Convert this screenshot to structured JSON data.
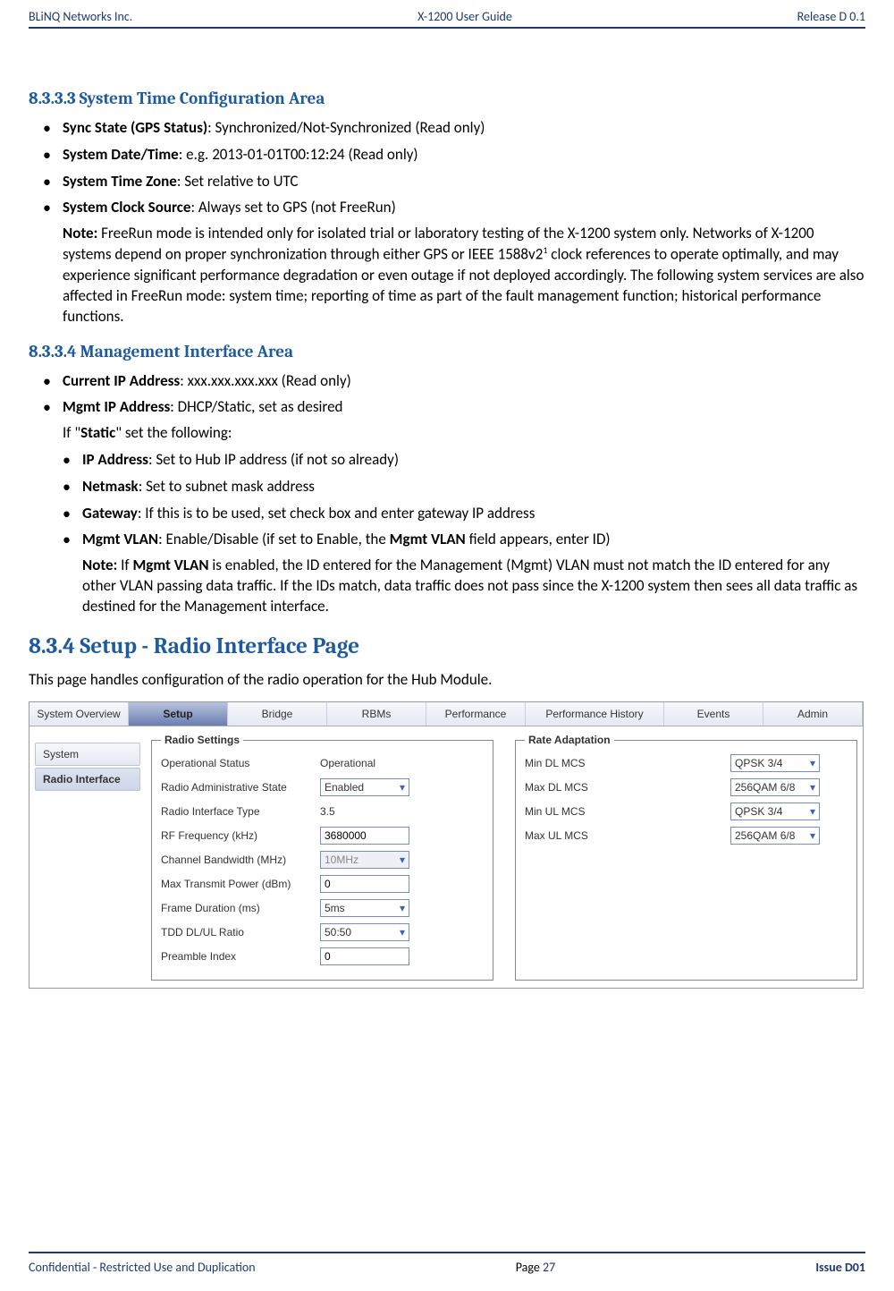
{
  "header": {
    "left": "BLiNQ Networks Inc.",
    "center": "X-1200 User Guide",
    "right": "Release D 0.1"
  },
  "footer": {
    "left": "Confidential - Restricted Use and Duplication",
    "center_prefix": "Page ",
    "center_num": "27",
    "right": "Issue D01"
  },
  "sections": {
    "h_8333": "8.3.3.3 System Time Configuration Area",
    "b8333": {
      "i0_b": "Sync State (GPS Status)",
      "i0_t": ": Synchronized/Not-Synchronized (Read only)",
      "i1_b": "System Date/Time",
      "i1_t": ": e.g. 2013-01-01T00:12:24 (Read only)",
      "i2_b": "System Time Zone",
      "i2_t": ": Set relative to UTC",
      "i3_b": "System Clock Source",
      "i3_t": ": Always set to GPS (not FreeRun)"
    },
    "note8333_b": "Note:",
    "note8333_t1": " FreeRun mode is intended only for isolated trial or laboratory testing of the X-1200 system only. Networks of X-1200 systems depend on proper synchronization through either GPS or IEEE 1588v2",
    "note8333_sup": "1",
    "note8333_t2": " clock references to operate optimally, and may experience significant performance degradation or even outage if not deployed accordingly. The following system services are also affected in FreeRun mode: system time; reporting of time as part of the fault management function; historical performance functions.",
    "h_8334": "8.3.3.4 Management Interface Area",
    "b8334": {
      "i0_b": "Current IP Address",
      "i0_t": ": xxx.xxx.xxx.xxx (Read only)",
      "i1_b": "Mgmt IP Address",
      "i1_t": ": DHCP/Static, set as desired"
    },
    "static_line_a": "If \"",
    "static_line_b": "Static",
    "static_line_c": "\" set the following:",
    "sub8334": {
      "i0_b": "IP Address",
      "i0_t": ": Set to Hub IP address (if not so already)",
      "i1_b": "Netmask",
      "i1_t": ": Set to subnet mask address",
      "i2_b": "Gateway",
      "i2_t": ": If this is to be used, set check box and enter gateway IP address",
      "i3_b": "Mgmt VLAN",
      "i3_t1": ": Enable/Disable (if set to Enable, the ",
      "i3_b2": "Mgmt VLAN",
      "i3_t2": " field appears, enter ID)"
    },
    "note8334_b": "Note:",
    "note8334_t1": " If ",
    "note8334_b2": "Mgmt VLAN",
    "note8334_t2": " is enabled, the ID entered for the Management (Mgmt) VLAN must not match the ID entered for any other VLAN passing data traffic. If the IDs match, data traffic does not pass since the X-1200 system then sees all data traffic as destined for the Management interface.",
    "h_834": "8.3.4 Setup - Radio Interface Page",
    "intro834": "This page handles configuration of the radio operation for the Hub Module."
  },
  "ui": {
    "tabs": [
      "System Overview",
      "Setup",
      "Bridge",
      "RBMs",
      "Performance",
      "Performance History",
      "Events",
      "Admin"
    ],
    "active_tab": "Setup",
    "side": [
      "System",
      "Radio Interface"
    ],
    "active_side": "Radio Interface",
    "panel_left_title": "Radio Settings",
    "panel_right_title": "Rate Adaptation",
    "radio": {
      "r0l": "Operational Status",
      "r0v": "Operational",
      "r1l": "Radio Administrative State",
      "r1v": "Enabled",
      "r2l": "Radio Interface Type",
      "r2v": "3.5",
      "r3l": "RF Frequency (kHz)",
      "r3v": "3680000",
      "r4l": "Channel Bandwidth (MHz)",
      "r4v": "10MHz",
      "r5l": "Max Transmit Power (dBm)",
      "r5v": "0",
      "r6l": "Frame Duration (ms)",
      "r6v": "5ms",
      "r7l": "TDD DL/UL Ratio",
      "r7v": "50:50",
      "r8l": "Preamble Index",
      "r8v": "0"
    },
    "rate": {
      "r0l": "Min DL MCS",
      "r0v": "QPSK 3/4",
      "r1l": "Max DL MCS",
      "r1v": "256QAM 6/8",
      "r2l": "Min UL MCS",
      "r2v": "QPSK 3/4",
      "r3l": "Max UL MCS",
      "r3v": "256QAM 6/8"
    }
  }
}
